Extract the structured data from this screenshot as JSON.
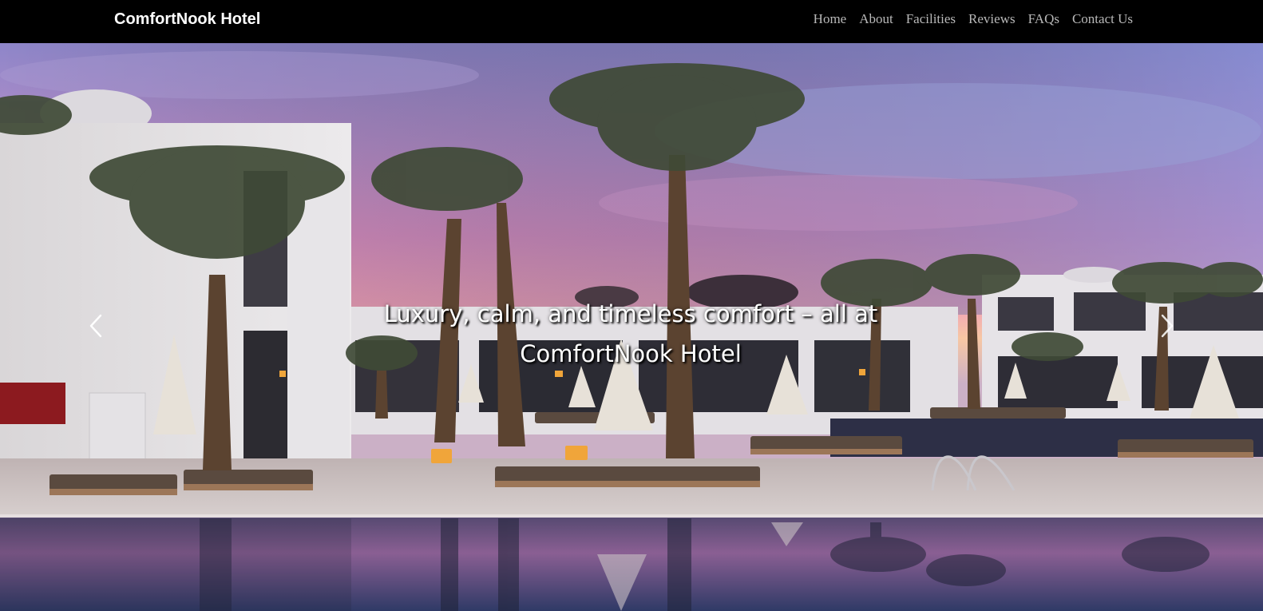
{
  "brand": {
    "name": "ComfortNook Hotel"
  },
  "nav": {
    "links": [
      {
        "label": "Home"
      },
      {
        "label": "About"
      },
      {
        "label": "Facilities"
      },
      {
        "label": "Reviews"
      },
      {
        "label": "FAQs"
      },
      {
        "label": "Contact Us"
      }
    ]
  },
  "hero": {
    "caption_line1": "Luxury, calm, and timeless comfort – all at",
    "caption_line2": "ComfortNook Hotel",
    "prev_icon": "chevron-left-icon",
    "next_icon": "chevron-right-icon"
  },
  "colors": {
    "navbar_bg": "#000000",
    "brand_text": "#ffffff",
    "nav_link_text": "#b8b8b8",
    "caption_text": "#ffffff"
  }
}
